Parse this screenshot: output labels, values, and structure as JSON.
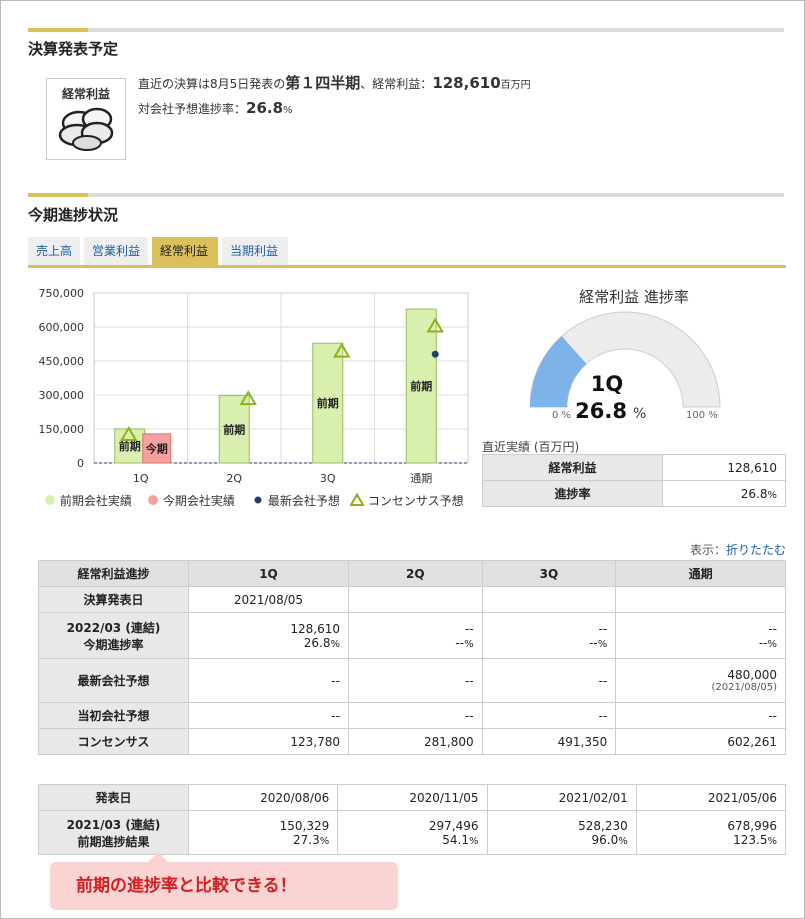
{
  "section1": {
    "title": "決算発表予定",
    "icon_label": "経常利益",
    "icon": "cloudy-weather-icon",
    "line1_prefix": "直近の決算は8月5日発表の",
    "line1_period": "第１四半期",
    "line1_mid": "、経常利益：",
    "line1_value": "128,610",
    "line1_unit": "百万円",
    "line2_prefix": "対会社予想進捗率：",
    "line2_value": "26.8",
    "line2_unit": "%"
  },
  "section2": {
    "title": "今期進捗状況",
    "tabs": [
      "売上高",
      "営業利益",
      "経常利益",
      "当期利益"
    ],
    "active_tab": "経常利益"
  },
  "chart_data": {
    "type": "bar",
    "categories": [
      "1Q",
      "2Q",
      "3Q",
      "通期"
    ],
    "ylim": [
      0,
      750000
    ],
    "yticks": [
      "0",
      "150,000",
      "300,000",
      "450,000",
      "600,000",
      "750,000"
    ],
    "series": [
      {
        "name": "前期会社実績",
        "color": "#d9efae",
        "values": [
          150329,
          297496,
          528230,
          678996
        ],
        "bar_label": "前期"
      },
      {
        "name": "今期会社実績",
        "color": "#f7a0a0",
        "values": [
          128610,
          null,
          null,
          null
        ],
        "bar_label": "今期"
      },
      {
        "name": "最新会社予想",
        "color": "#1f3d73",
        "values": [
          null,
          null,
          null,
          480000
        ]
      },
      {
        "name": "コンセンサス予想",
        "color": "#8fae1b",
        "values": [
          123780,
          281800,
          491350,
          602261
        ]
      }
    ]
  },
  "gauge": {
    "title": "経常利益 進捗率",
    "quarter": "1Q",
    "value": "26.8",
    "unit": "%",
    "fraction": 0.268,
    "min_label": "0 %",
    "max_label": "100 %",
    "fill_color": "#7eb3ea",
    "track_color": "#ececec"
  },
  "mini_table": {
    "caption": "直近実績 (百万円)",
    "rows": [
      {
        "label": "経常利益",
        "value": "128,610"
      },
      {
        "label": "進捗率",
        "value": "26.8",
        "unit": "%"
      }
    ]
  },
  "display_option": {
    "label": "表示：",
    "link": "折りたたむ"
  },
  "progress_table": {
    "headers": [
      "経常利益進捗",
      "1Q",
      "2Q",
      "3Q",
      "通期"
    ],
    "announce_row": {
      "label": "決算発表日",
      "values": [
        "2021/08/05",
        "",
        "",
        ""
      ]
    },
    "current_row": {
      "label1": "2022/03 (連結)",
      "label2": "今期進捗率",
      "values": [
        "128,610",
        "--",
        "--",
        "--"
      ],
      "rates": [
        "26.8",
        "--",
        "--",
        "--"
      ]
    },
    "latest_row": {
      "label": "最新会社予想",
      "values": [
        "--",
        "--",
        "--",
        "480,000"
      ],
      "date": "(2021/08/05)"
    },
    "initial_row": {
      "label": "当初会社予想",
      "values": [
        "--",
        "--",
        "--",
        "--"
      ]
    },
    "consensus_row": {
      "label": "コンセンサス",
      "values": [
        "123,780",
        "281,800",
        "491,350",
        "602,261"
      ]
    }
  },
  "prev_table": {
    "date_row": {
      "label": "発表日",
      "values": [
        "2020/08/06",
        "2020/11/05",
        "2021/02/01",
        "2021/05/06"
      ]
    },
    "result_row": {
      "label1": "2021/03 (連結)",
      "label2": "前期進捗結果",
      "values": [
        "150,329",
        "297,496",
        "528,230",
        "678,996"
      ],
      "rates": [
        "27.3",
        "54.1",
        "96.0",
        "123.5"
      ]
    }
  },
  "callout": "前期の進捗率と比較できる！",
  "pct_sign": "%"
}
